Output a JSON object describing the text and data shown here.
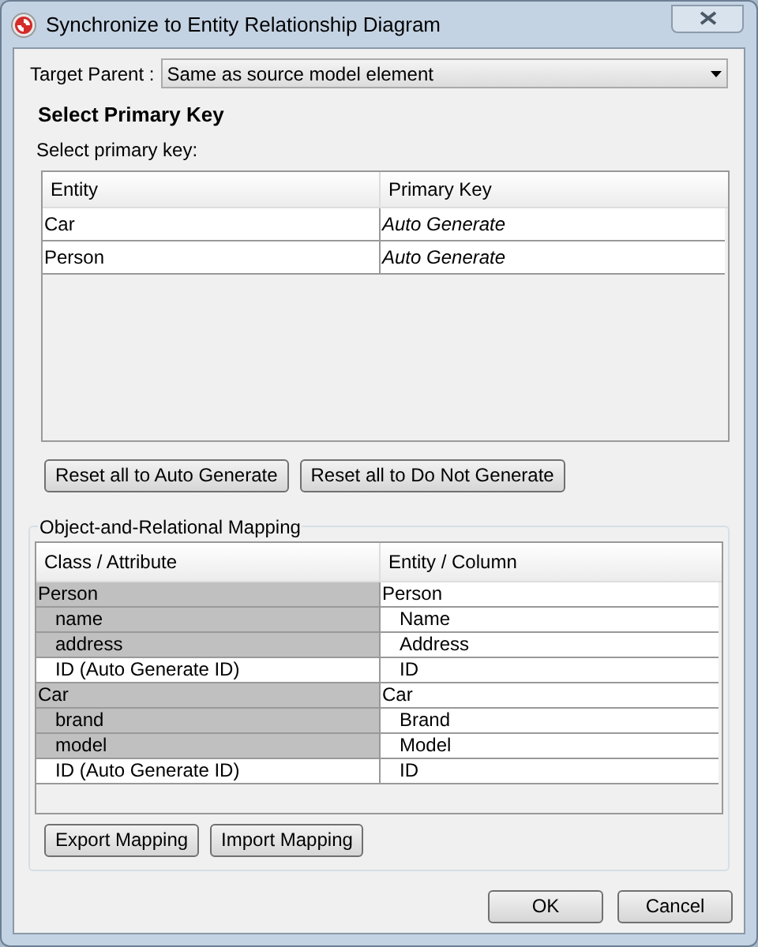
{
  "window": {
    "title": "Synchronize to Entity Relationship Diagram"
  },
  "target_parent": {
    "label": "Target Parent :",
    "value": "Same as source model element"
  },
  "primary_key": {
    "heading": "Select Primary Key",
    "instruction": "Select primary key:",
    "columns": [
      "Entity",
      "Primary Key"
    ],
    "rows": [
      {
        "entity": "Car",
        "primary_key": "Auto Generate"
      },
      {
        "entity": "Person",
        "primary_key": "Auto Generate"
      }
    ],
    "buttons": [
      "Reset all to Auto Generate",
      "Reset all to Do Not Generate"
    ]
  },
  "mapping": {
    "title": "Object-and-Relational Mapping",
    "columns": [
      "Class / Attribute",
      "Entity / Column"
    ],
    "rows": [
      {
        "class": "Person",
        "entity": "Person",
        "shaded": true,
        "children": [
          {
            "class": "name",
            "entity": "Name",
            "shaded": true
          },
          {
            "class": "address",
            "entity": "Address",
            "shaded": true
          },
          {
            "class": "ID (Auto Generate ID)",
            "entity": "ID",
            "shaded": false
          }
        ]
      },
      {
        "class": "Car",
        "entity": "Car",
        "shaded": true,
        "children": [
          {
            "class": "brand",
            "entity": "Brand",
            "shaded": true
          },
          {
            "class": "model",
            "entity": "Model",
            "shaded": true
          },
          {
            "class": "ID (Auto Generate ID)",
            "entity": "ID",
            "shaded": false
          }
        ]
      }
    ],
    "buttons": [
      "Export Mapping",
      "Import Mapping"
    ]
  },
  "buttons": [
    "OK",
    "Cancel"
  ]
}
